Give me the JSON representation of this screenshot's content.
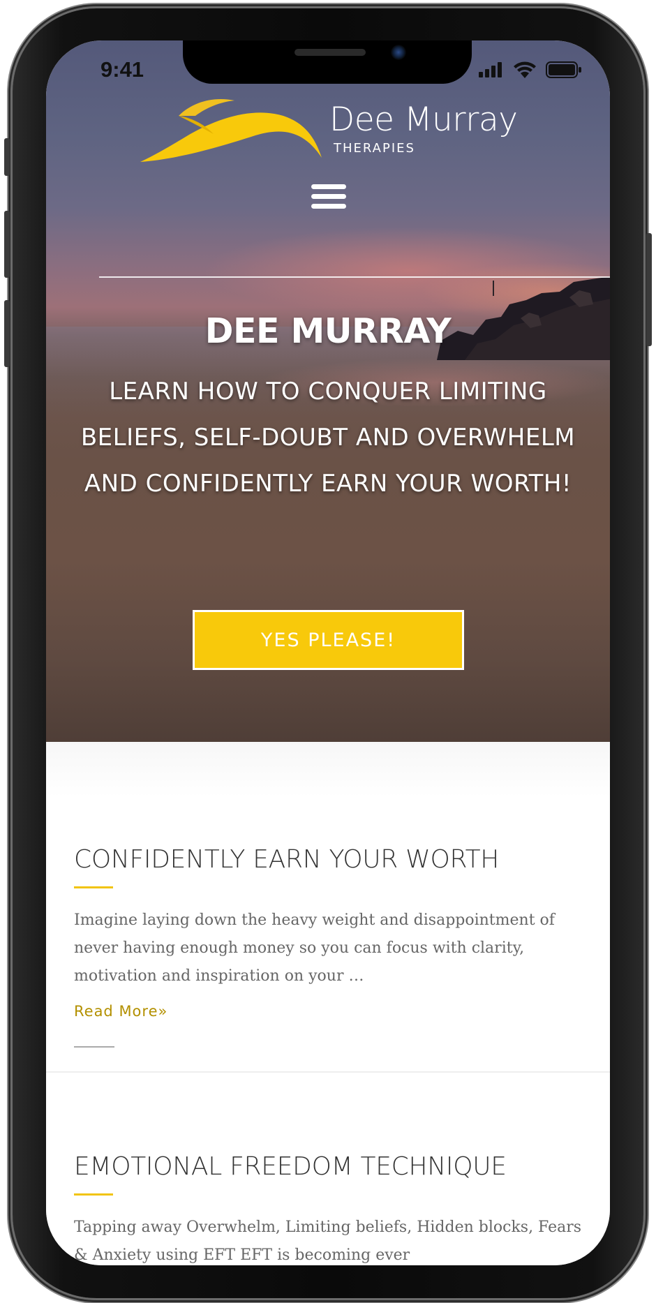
{
  "status_bar": {
    "time": "9:41",
    "icons": [
      "signal-icon",
      "wifi-icon",
      "battery-icon"
    ]
  },
  "brand": {
    "name": "Dee Murray",
    "subtitle": "THERAPIES",
    "accent_color": "#f8c90b"
  },
  "nav": {
    "menu_icon": "hamburger-menu-icon"
  },
  "hero": {
    "title": "DEE MURRAY",
    "text": "LEARN HOW TO CONQUER LIMITING BELIEFS, SELF-DOUBT AND OVERWHELM AND CONFIDENTLY EARN YOUR WORTH!",
    "cta_label": "YES PLEASE!"
  },
  "posts": [
    {
      "title": "CONFIDENTLY EARN YOUR WORTH",
      "excerpt": "Imagine laying down the heavy weight and disappointment of never having enough money so you can focus with clarity, motivation and inspiration on your …",
      "read_more": "Read More»"
    },
    {
      "title": "EMOTIONAL FREEDOM TECHNIQUE",
      "excerpt": "Tapping away Overwhelm, Limiting beliefs, Hidden blocks, Fears & Anxiety using EFT EFT is becoming ever"
    }
  ]
}
